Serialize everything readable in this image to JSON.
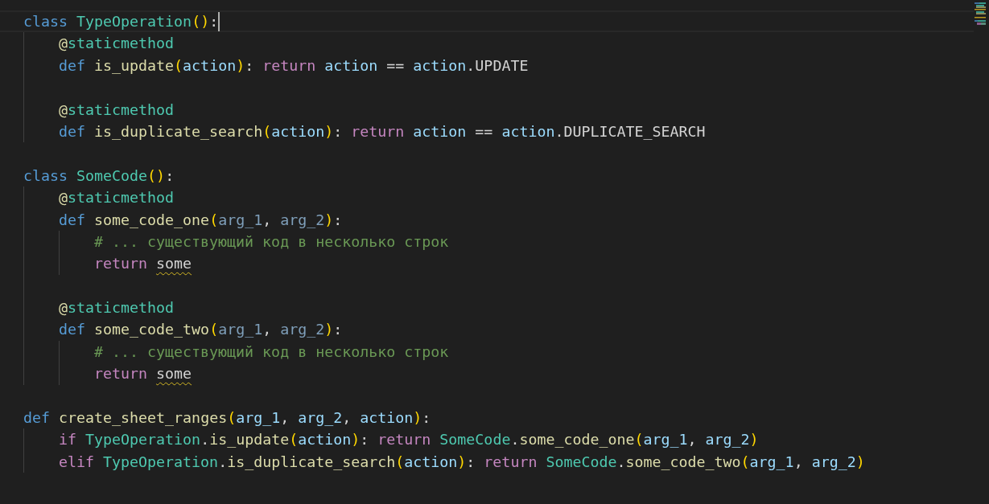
{
  "editor": {
    "lines": [
      {
        "kind": "code",
        "current": true,
        "tokens": [
          {
            "kind": "kw",
            "text": "class "
          },
          {
            "kind": "cls",
            "text": "TypeOperation"
          },
          {
            "kind": "br",
            "text": "()"
          },
          {
            "kind": "p",
            "text": ":"
          }
        ],
        "children": [
          {
            "kind": "code",
            "current": false,
            "tokens": [
              {
                "kind": "deco",
                "text": "@"
              },
              {
                "kind": "cls",
                "text": "staticmethod"
              }
            ]
          },
          {
            "kind": "code",
            "current": false,
            "tokens": [
              {
                "kind": "kw",
                "text": "def "
              },
              {
                "kind": "fn",
                "text": "is_update"
              },
              {
                "kind": "br",
                "text": "("
              },
              {
                "kind": "var",
                "text": "action"
              },
              {
                "kind": "br",
                "text": ")"
              },
              {
                "kind": "p",
                "text": ": "
              },
              {
                "kind": "ctl",
                "text": "return "
              },
              {
                "kind": "var",
                "text": "action"
              },
              {
                "kind": "p",
                "text": " == "
              },
              {
                "kind": "var",
                "text": "action"
              },
              {
                "kind": "p",
                "text": ".UPDATE"
              }
            ]
          },
          {
            "kind": "blank"
          },
          {
            "kind": "code",
            "current": false,
            "tokens": [
              {
                "kind": "deco",
                "text": "@"
              },
              {
                "kind": "cls",
                "text": "staticmethod"
              }
            ]
          },
          {
            "kind": "code",
            "current": false,
            "tokens": [
              {
                "kind": "kw",
                "text": "def "
              },
              {
                "kind": "fn",
                "text": "is_duplicate_search"
              },
              {
                "kind": "br",
                "text": "("
              },
              {
                "kind": "var",
                "text": "action"
              },
              {
                "kind": "br",
                "text": ")"
              },
              {
                "kind": "p",
                "text": ": "
              },
              {
                "kind": "ctl",
                "text": "return "
              },
              {
                "kind": "var",
                "text": "action"
              },
              {
                "kind": "p",
                "text": " == "
              },
              {
                "kind": "var",
                "text": "action"
              },
              {
                "kind": "p",
                "text": ".DUPLICATE_SEARCH"
              }
            ]
          }
        ]
      },
      {
        "kind": "blank"
      },
      {
        "kind": "code",
        "current": false,
        "tokens": [
          {
            "kind": "kw",
            "text": "class "
          },
          {
            "kind": "cls",
            "text": "SomeCode"
          },
          {
            "kind": "br",
            "text": "()"
          },
          {
            "kind": "p",
            "text": ":"
          }
        ],
        "children": [
          {
            "kind": "code",
            "current": false,
            "tokens": [
              {
                "kind": "deco",
                "text": "@"
              },
              {
                "kind": "cls",
                "text": "staticmethod"
              }
            ]
          },
          {
            "kind": "code",
            "current": false,
            "tokens": [
              {
                "kind": "kw",
                "text": "def "
              },
              {
                "kind": "fn",
                "text": "some_code_one"
              },
              {
                "kind": "br",
                "text": "("
              },
              {
                "kind": "dim",
                "text": "arg_1"
              },
              {
                "kind": "p",
                "text": ", "
              },
              {
                "kind": "dim",
                "text": "arg_2"
              },
              {
                "kind": "br",
                "text": ")"
              },
              {
                "kind": "p",
                "text": ":"
              }
            ],
            "children": [
              {
                "kind": "code",
                "current": false,
                "tokens": [
                  {
                    "kind": "cmt",
                    "text": "# ... существующий код в несколько строк"
                  }
                ]
              },
              {
                "kind": "code",
                "current": false,
                "tokens": [
                  {
                    "kind": "ctl",
                    "text": "return "
                  },
                  {
                    "kind": "p",
                    "text": "some",
                    "warning": true
                  }
                ]
              }
            ]
          },
          {
            "kind": "blank"
          },
          {
            "kind": "code",
            "current": false,
            "tokens": [
              {
                "kind": "deco",
                "text": "@"
              },
              {
                "kind": "cls",
                "text": "staticmethod"
              }
            ]
          },
          {
            "kind": "code",
            "current": false,
            "tokens": [
              {
                "kind": "kw",
                "text": "def "
              },
              {
                "kind": "fn",
                "text": "some_code_two"
              },
              {
                "kind": "br",
                "text": "("
              },
              {
                "kind": "dim",
                "text": "arg_1"
              },
              {
                "kind": "p",
                "text": ", "
              },
              {
                "kind": "dim",
                "text": "arg_2"
              },
              {
                "kind": "br",
                "text": ")"
              },
              {
                "kind": "p",
                "text": ":"
              }
            ],
            "children": [
              {
                "kind": "code",
                "current": false,
                "tokens": [
                  {
                    "kind": "cmt",
                    "text": "# ... существующий код в несколько строк"
                  }
                ]
              },
              {
                "kind": "code",
                "current": false,
                "tokens": [
                  {
                    "kind": "ctl",
                    "text": "return "
                  },
                  {
                    "kind": "p",
                    "text": "some",
                    "warning": true
                  }
                ]
              }
            ]
          }
        ]
      },
      {
        "kind": "blank"
      },
      {
        "kind": "code",
        "current": false,
        "tokens": [
          {
            "kind": "kw",
            "text": "def "
          },
          {
            "kind": "fn",
            "text": "create_sheet_ranges"
          },
          {
            "kind": "br",
            "text": "("
          },
          {
            "kind": "var",
            "text": "arg_1"
          },
          {
            "kind": "p",
            "text": ", "
          },
          {
            "kind": "var",
            "text": "arg_2"
          },
          {
            "kind": "p",
            "text": ", "
          },
          {
            "kind": "var",
            "text": "action"
          },
          {
            "kind": "br",
            "text": ")"
          },
          {
            "kind": "p",
            "text": ":"
          }
        ],
        "children": [
          {
            "kind": "code",
            "current": false,
            "tokens": [
              {
                "kind": "ctl",
                "text": "if "
              },
              {
                "kind": "cls",
                "text": "TypeOperation"
              },
              {
                "kind": "p",
                "text": "."
              },
              {
                "kind": "fn",
                "text": "is_update"
              },
              {
                "kind": "br",
                "text": "("
              },
              {
                "kind": "var",
                "text": "action"
              },
              {
                "kind": "br",
                "text": ")"
              },
              {
                "kind": "p",
                "text": ": "
              },
              {
                "kind": "ctl",
                "text": "return "
              },
              {
                "kind": "cls",
                "text": "SomeCode"
              },
              {
                "kind": "p",
                "text": "."
              },
              {
                "kind": "fn",
                "text": "some_code_one"
              },
              {
                "kind": "br",
                "text": "("
              },
              {
                "kind": "var",
                "text": "arg_1"
              },
              {
                "kind": "p",
                "text": ", "
              },
              {
                "kind": "var",
                "text": "arg_2"
              },
              {
                "kind": "br",
                "text": ")"
              }
            ]
          },
          {
            "kind": "code",
            "current": false,
            "tokens": [
              {
                "kind": "ctl",
                "text": "elif "
              },
              {
                "kind": "cls",
                "text": "TypeOperation"
              },
              {
                "kind": "p",
                "text": "."
              },
              {
                "kind": "fn",
                "text": "is_duplicate_search"
              },
              {
                "kind": "br",
                "text": "("
              },
              {
                "kind": "var",
                "text": "action"
              },
              {
                "kind": "br",
                "text": ")"
              },
              {
                "kind": "p",
                "text": ": "
              },
              {
                "kind": "ctl",
                "text": "return "
              },
              {
                "kind": "cls",
                "text": "SomeCode"
              },
              {
                "kind": "p",
                "text": "."
              },
              {
                "kind": "fn",
                "text": "some_code_two"
              },
              {
                "kind": "br",
                "text": "("
              },
              {
                "kind": "var",
                "text": "arg_1"
              },
              {
                "kind": "p",
                "text": ", "
              },
              {
                "kind": "var",
                "text": "arg_2"
              },
              {
                "kind": "br",
                "text": ")"
              }
            ]
          }
        ]
      }
    ]
  }
}
